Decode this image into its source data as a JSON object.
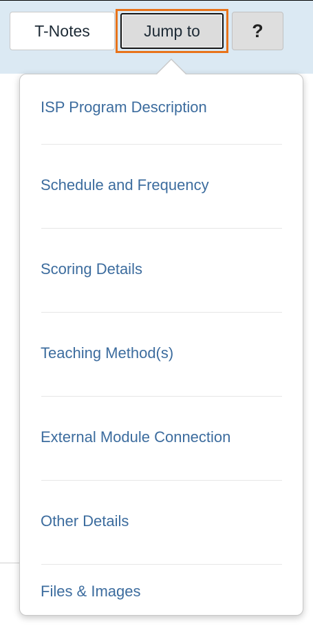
{
  "toolbar": {
    "tnotes_label": "T-Notes",
    "jump_label": "Jump to",
    "help_label": "?"
  },
  "menu": {
    "items": [
      {
        "label": "ISP Program Description"
      },
      {
        "label": "Schedule and Frequency"
      },
      {
        "label": "Scoring Details"
      },
      {
        "label": "Teaching Method(s)"
      },
      {
        "label": "External Module Connection"
      },
      {
        "label": "Other Details"
      },
      {
        "label": "Files & Images"
      }
    ]
  },
  "colors": {
    "menu_text": "#3c6c9e",
    "focus_ring": "#e8731a",
    "toolbar_background": "#dbe9f3",
    "button_text": "#1d2a35"
  }
}
